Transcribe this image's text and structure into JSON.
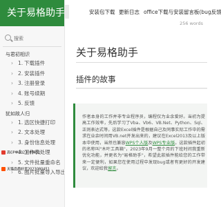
{
  "sidebar": {
    "brand": "关于易格助手",
    "search_placeholder": "搜索",
    "section1": "与君初相识",
    "items1": [
      {
        "num": "1.",
        "label": "下载插件"
      },
      {
        "num": "2.",
        "label": "安装插件"
      },
      {
        "num": "3.",
        "label": "注册登录"
      },
      {
        "num": "4.",
        "label": "账号续期"
      },
      {
        "num": "5.",
        "label": "反馈"
      }
    ],
    "section2": "犹如故人归",
    "items2": [
      {
        "num": "1.",
        "label": "选区快捷打印"
      },
      {
        "num": "2.",
        "label": "文本处理"
      },
      {
        "num": "3.",
        "label": "身份信息处理"
      },
      {
        "num": "4.",
        "label": "工作表处理"
      },
      {
        "num": "5.",
        "label": "文件批量重命名"
      },
      {
        "num": "6.",
        "label": "图片批量导入导出"
      }
    ]
  },
  "overlay": {
    "row1": "高CP单2023080451",
    "row2": "天猫品质好货2023080451"
  },
  "topnav": {
    "links": [
      "安装包下载",
      "更新日志",
      "office下载与安装",
      "留言板(bug反馈)"
    ],
    "views": "256 words"
  },
  "main": {
    "title": "关于易格助手",
    "subtitle": "插件的故事",
    "story_1": "作者本身的工作并非专业程序员，编程仅为业余爱好。当初为提高工作效率，先后学习了Vba、Vb6、VB.Net、Python、Sql、正则表达式等，这款Excel插件是根据自己及同事实际工作中的需求在业余时间用VB.net开发出来的，建议在Excel2013及以上版本中使用，当然也兼容",
    "link_wps": "WPS个人版",
    "story_2": "及",
    "link_wps2": "WPS专业版",
    "story_3": "。这款插件起初的名称叫\"木叶工具箱\"，2023年9月一整个月的下班时间我重新优化功能，并更名为\"易格助手\"，希望此款插件能给您的工作带来一定便利，如果您在使用过程中发现bug或者有更好的开发建议，欢迎给我",
    "link_msg": "留言",
    "story_4": "。"
  },
  "colors": {
    "brand": "#2e8b3d",
    "quote_bg": "#f3f5f3"
  }
}
